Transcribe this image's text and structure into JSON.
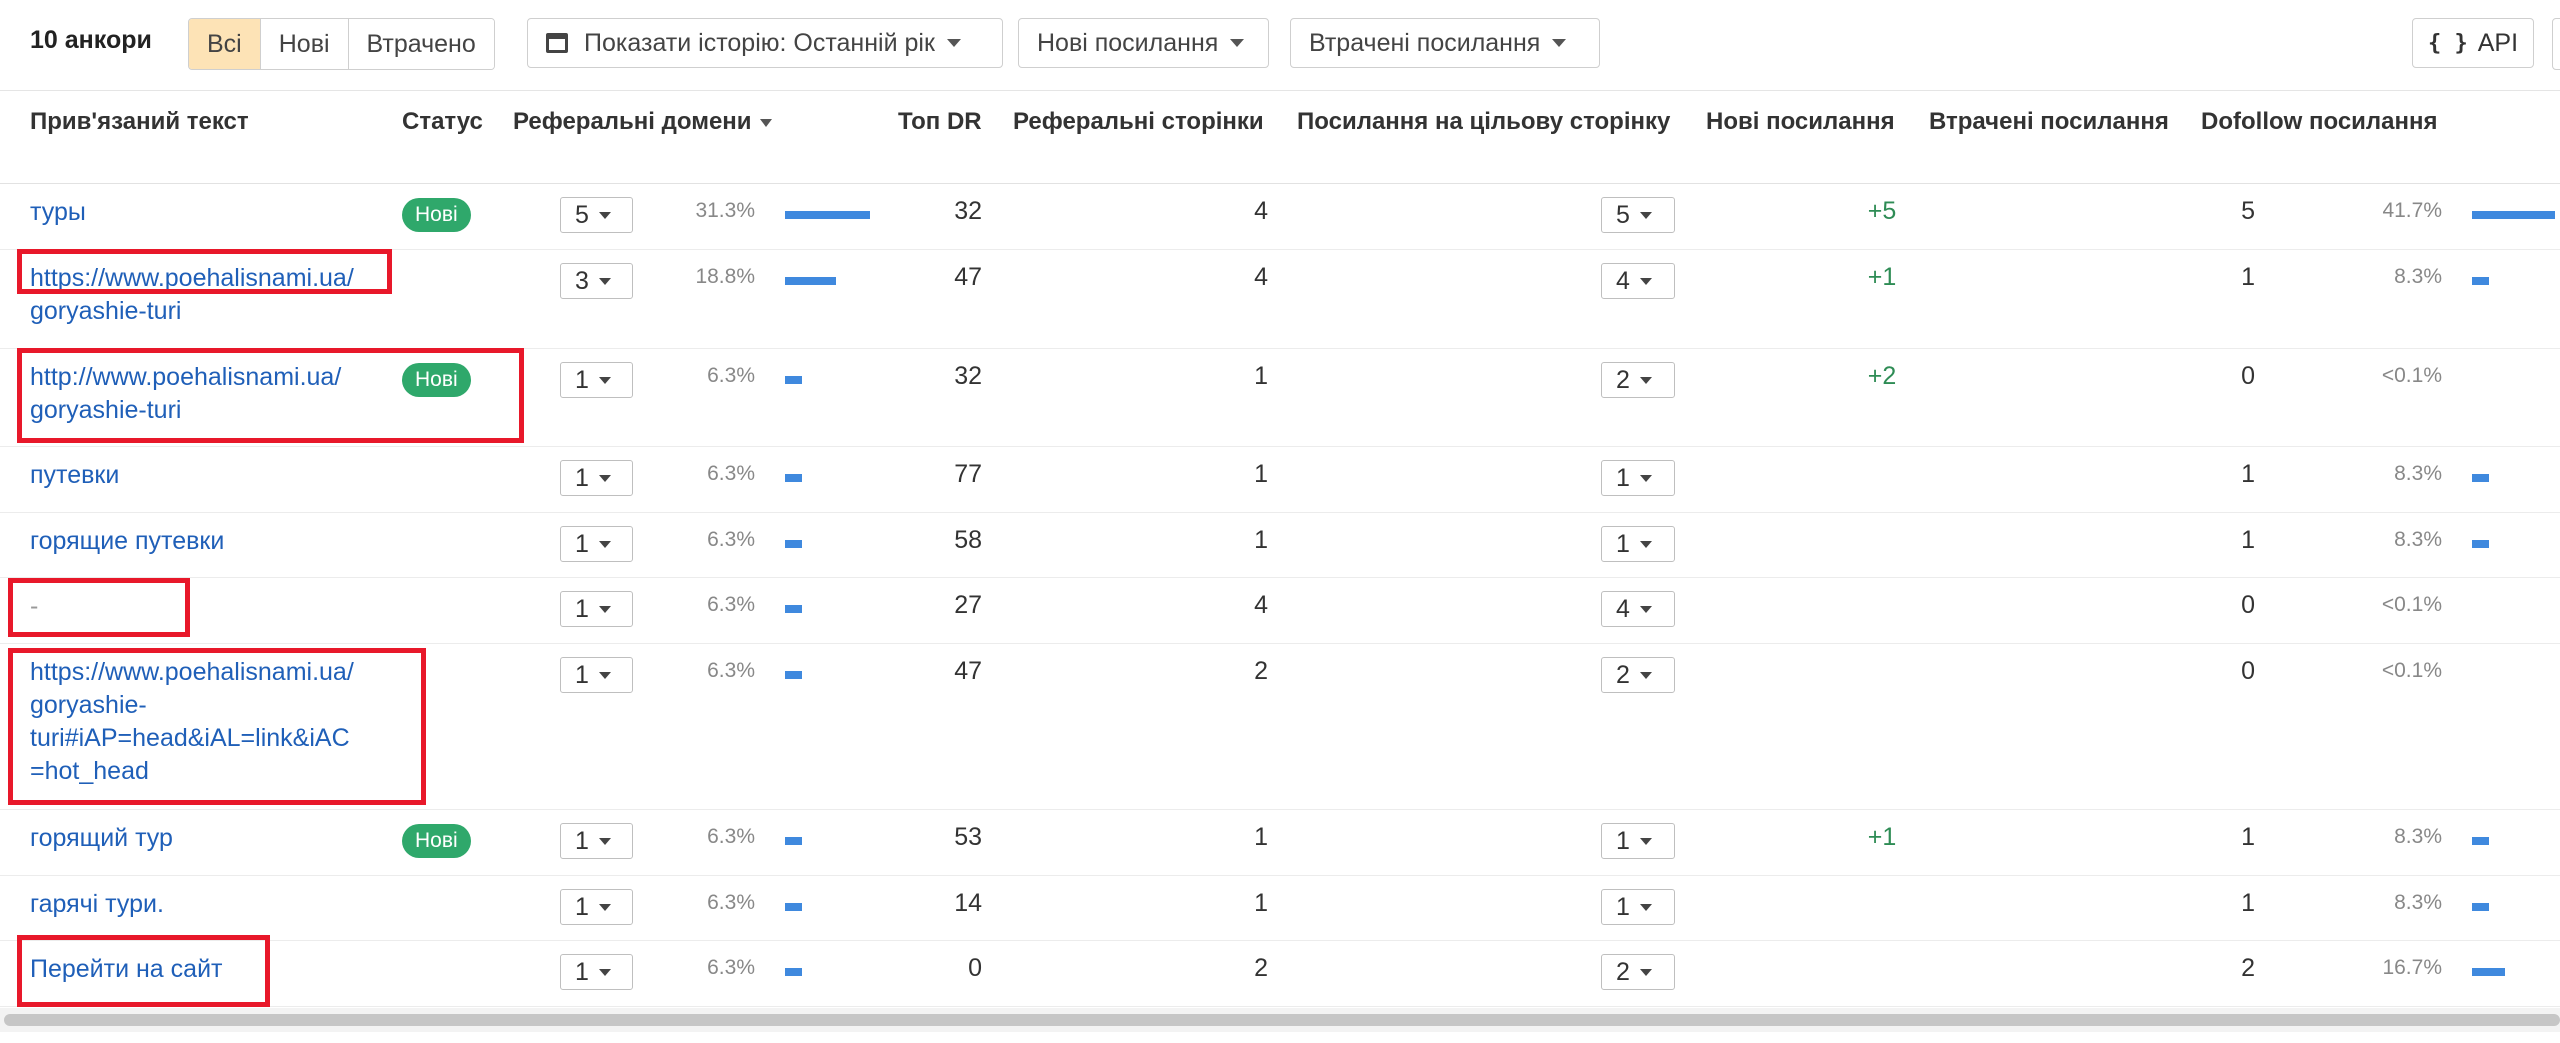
{
  "toolbar": {
    "count_label": "10 анкори",
    "filters": [
      "Всі",
      "Нові",
      "Втрачено"
    ],
    "history_label": "Показати історію: Останній рік",
    "new_links_label": "Нові посилання",
    "lost_links_label": "Втрачені посилання",
    "api_label": "API",
    "api_icon": "{ }"
  },
  "columns": {
    "anchor": "Прив'язаний текст",
    "status": "Статус",
    "ref_domains": "Реферальні домени",
    "top_dr": "Топ DR",
    "ref_pages": "Реферальні сторінки",
    "target_links": "Посилання на цільову сторінку",
    "new_links": "Нові посилання",
    "lost_links": "Втрачені посилання",
    "dofollow": "Dofollow посилання"
  },
  "rows": [
    {
      "anchor": "туры",
      "status": "Нові",
      "domains": "5",
      "domains_pct": "31.3%",
      "domains_share": 0.313,
      "dr": "32",
      "pages": "4",
      "targets": "5",
      "new": "+5",
      "dofollow": "5",
      "dofollow_pct": "41.7%",
      "dofollow_share": 0.417
    },
    {
      "anchor": "https://www.poehalisnami.ua/\ngoryashie-turi",
      "status": "",
      "domains": "3",
      "domains_pct": "18.8%",
      "domains_share": 0.188,
      "dr": "47",
      "pages": "4",
      "targets": "4",
      "new": "+1",
      "dofollow": "1",
      "dofollow_pct": "8.3%",
      "dofollow_share": 0.083
    },
    {
      "anchor": "http://www.poehalisnami.ua/\ngoryashie-turi",
      "status": "Нові",
      "domains": "1",
      "domains_pct": "6.3%",
      "domains_share": 0.063,
      "dr": "32",
      "pages": "1",
      "targets": "2",
      "new": "+2",
      "dofollow": "0",
      "dofollow_pct": "<0.1%",
      "dofollow_share": 0
    },
    {
      "anchor": "путевки",
      "status": "",
      "domains": "1",
      "domains_pct": "6.3%",
      "domains_share": 0.063,
      "dr": "77",
      "pages": "1",
      "targets": "1",
      "new": "",
      "dofollow": "1",
      "dofollow_pct": "8.3%",
      "dofollow_share": 0.083
    },
    {
      "anchor": "горящие путевки",
      "status": "",
      "domains": "1",
      "domains_pct": "6.3%",
      "domains_share": 0.063,
      "dr": "58",
      "pages": "1",
      "targets": "1",
      "new": "",
      "dofollow": "1",
      "dofollow_pct": "8.3%",
      "dofollow_share": 0.083
    },
    {
      "anchor": "-",
      "status": "",
      "domains": "1",
      "domains_pct": "6.3%",
      "domains_share": 0.063,
      "dr": "27",
      "pages": "4",
      "targets": "4",
      "new": "",
      "dofollow": "0",
      "dofollow_pct": "<0.1%",
      "dofollow_share": 0
    },
    {
      "anchor": "https://www.poehalisnami.ua/\ngoryashie-\nturi#iAP=head&iAL=link&iAC\n=hot_head",
      "status": "",
      "domains": "1",
      "domains_pct": "6.3%",
      "domains_share": 0.063,
      "dr": "47",
      "pages": "2",
      "targets": "2",
      "new": "",
      "dofollow": "0",
      "dofollow_pct": "<0.1%",
      "dofollow_share": 0
    },
    {
      "anchor": "горящий тур",
      "status": "Нові",
      "domains": "1",
      "domains_pct": "6.3%",
      "domains_share": 0.063,
      "dr": "53",
      "pages": "1",
      "targets": "1",
      "new": "+1",
      "dofollow": "1",
      "dofollow_pct": "8.3%",
      "dofollow_share": 0.083
    },
    {
      "anchor": "гарячі тури.",
      "status": "",
      "domains": "1",
      "domains_pct": "6.3%",
      "domains_share": 0.063,
      "dr": "14",
      "pages": "1",
      "targets": "1",
      "new": "",
      "dofollow": "1",
      "dofollow_pct": "8.3%",
      "dofollow_share": 0.083
    },
    {
      "anchor": "Перейти на сайт",
      "status": "",
      "domains": "1",
      "domains_pct": "6.3%",
      "domains_share": 0.063,
      "dr": "0",
      "pages": "2",
      "targets": "2",
      "new": "",
      "dofollow": "2",
      "dofollow_pct": "16.7%",
      "dofollow_share": 0.167
    }
  ],
  "colors": {
    "link": "#1f5fb8",
    "badge_new": "#2fa86b",
    "bar": "#3f89de",
    "positive": "#2e8c55",
    "annotation": "#e8182a",
    "active_filter": "#fde3b6"
  }
}
